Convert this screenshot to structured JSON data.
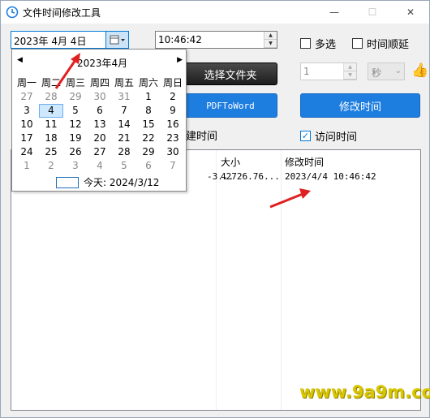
{
  "window": {
    "title": "文件时间修改工具",
    "minimize": "—",
    "maximize": "☐",
    "close": "✕"
  },
  "date_picker": {
    "value": "2023年 4月 4日",
    "calendar": {
      "title": "2023年4月",
      "prev": "◀",
      "next": "▶",
      "weekdays": [
        "周一",
        "周二",
        "周三",
        "周四",
        "周五",
        "周六",
        "周日"
      ],
      "weeks": [
        [
          {
            "d": "27",
            "o": true
          },
          {
            "d": "28",
            "o": true
          },
          {
            "d": "29",
            "o": true
          },
          {
            "d": "30",
            "o": true
          },
          {
            "d": "31",
            "o": true
          },
          {
            "d": "1"
          },
          {
            "d": "2"
          }
        ],
        [
          {
            "d": "3"
          },
          {
            "d": "4",
            "s": true
          },
          {
            "d": "5"
          },
          {
            "d": "6"
          },
          {
            "d": "7"
          },
          {
            "d": "8"
          },
          {
            "d": "9"
          }
        ],
        [
          {
            "d": "10"
          },
          {
            "d": "11"
          },
          {
            "d": "12"
          },
          {
            "d": "13"
          },
          {
            "d": "14"
          },
          {
            "d": "15"
          },
          {
            "d": "16"
          }
        ],
        [
          {
            "d": "17"
          },
          {
            "d": "18"
          },
          {
            "d": "19"
          },
          {
            "d": "20"
          },
          {
            "d": "21"
          },
          {
            "d": "22"
          },
          {
            "d": "23"
          }
        ],
        [
          {
            "d": "24"
          },
          {
            "d": "25"
          },
          {
            "d": "26"
          },
          {
            "d": "27"
          },
          {
            "d": "28"
          },
          {
            "d": "29"
          },
          {
            "d": "30"
          }
        ],
        [
          {
            "d": "1",
            "o": true
          },
          {
            "d": "2",
            "o": true
          },
          {
            "d": "3",
            "o": true
          },
          {
            "d": "4",
            "o": true
          },
          {
            "d": "5",
            "o": true
          },
          {
            "d": "6",
            "o": true
          },
          {
            "d": "7",
            "o": true
          }
        ]
      ],
      "today": "今天: 2024/3/12"
    }
  },
  "time_field": {
    "value": "10:46:42"
  },
  "options": {
    "multi_select": "多选",
    "time_order": "时间顺延",
    "offset_value": "1",
    "offset_unit": "秒",
    "access_time": "访问时间",
    "create_time_partial": "建时间"
  },
  "buttons": {
    "select_folder": "选择文件夹",
    "pdf_to_word": "PDFToWord",
    "modify_time": "修改时间"
  },
  "file_list": {
    "columns": {
      "size": "大小",
      "modified": "修改时间"
    },
    "rows": [
      {
        "name_partial": "-3...",
        "size": "42726.76...",
        "modified": "2023/4/4 10:46:42"
      }
    ]
  },
  "watermark": "www.9a9m.com",
  "colors": {
    "accent_blue": "#1e7ee0",
    "arrow_red": "#e02020",
    "watermark": "#d8c600"
  }
}
